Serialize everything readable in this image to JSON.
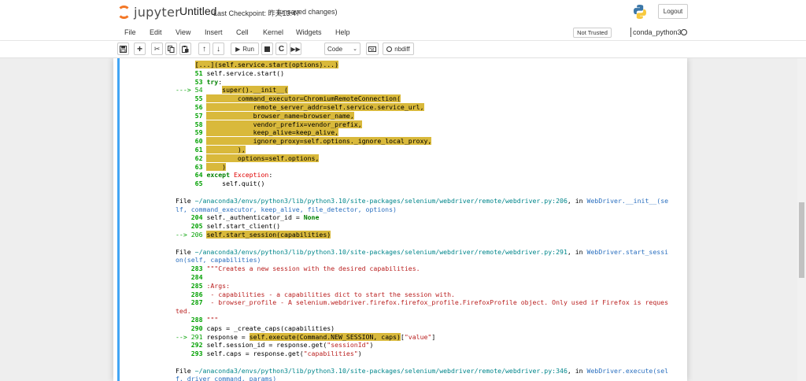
{
  "header": {
    "logo_text": "jupyter",
    "notebook_title": "Untitled",
    "checkpoint": "Last Checkpoint: 昨天13:47",
    "unsaved": "(unsaved changes)",
    "logout": "Logout"
  },
  "menu": {
    "items": [
      "File",
      "Edit",
      "View",
      "Insert",
      "Cell",
      "Kernel",
      "Widgets",
      "Help"
    ],
    "not_trusted": "Not Trusted",
    "kernel_name": "conda_python3"
  },
  "toolbar": {
    "run_label": "Run",
    "cell_type": "Code",
    "nbdiff_label": "nbdiff"
  },
  "colors": {
    "accent": "#f37726",
    "cell_bar": "#42a5f5",
    "highlight": "#d9b93b",
    "line_number": "#00a000",
    "exception": "#e00000",
    "link": "#2a6fbf"
  },
  "output_lines": [
    [
      {
        "t": "     ",
        "c": ""
      },
      {
        "t": "[...](self.service.start(options)...)",
        "c": "hl"
      }
    ],
    [
      {
        "t": "     ",
        "c": ""
      },
      {
        "t": "51",
        "c": "g"
      },
      {
        "t": " self.service.start()",
        "c": ""
      }
    ],
    [
      {
        "t": "     ",
        "c": ""
      },
      {
        "t": "53",
        "c": "g"
      },
      {
        "t": " ",
        "c": ""
      },
      {
        "t": "try",
        "c": "k"
      },
      {
        "t": ":",
        "c": ""
      }
    ],
    [
      {
        "t": "---> 54",
        "c": "gr"
      },
      {
        "t": "     ",
        "c": ""
      },
      {
        "t": "super().__init__(",
        "c": "hl"
      }
    ],
    [
      {
        "t": "     ",
        "c": ""
      },
      {
        "t": "55",
        "c": "g"
      },
      {
        "t": " ",
        "c": ""
      },
      {
        "t": "        command_executor=ChromiumRemoteConnection(",
        "c": "hl"
      }
    ],
    [
      {
        "t": "     ",
        "c": ""
      },
      {
        "t": "56",
        "c": "g"
      },
      {
        "t": " ",
        "c": ""
      },
      {
        "t": "            remote_server_addr=self.service.service_url,",
        "c": "hl"
      }
    ],
    [
      {
        "t": "     ",
        "c": ""
      },
      {
        "t": "57",
        "c": "g"
      },
      {
        "t": " ",
        "c": ""
      },
      {
        "t": "            browser_name=browser_name,",
        "c": "hl"
      }
    ],
    [
      {
        "t": "     ",
        "c": ""
      },
      {
        "t": "58",
        "c": "g"
      },
      {
        "t": " ",
        "c": ""
      },
      {
        "t": "            vendor_prefix=vendor_prefix,",
        "c": "hl"
      }
    ],
    [
      {
        "t": "     ",
        "c": ""
      },
      {
        "t": "59",
        "c": "g"
      },
      {
        "t": " ",
        "c": ""
      },
      {
        "t": "            keep_alive=keep_alive,",
        "c": "hl"
      }
    ],
    [
      {
        "t": "     ",
        "c": ""
      },
      {
        "t": "60",
        "c": "g"
      },
      {
        "t": " ",
        "c": ""
      },
      {
        "t": "            ignore_proxy=self.options._ignore_local_proxy,",
        "c": "hl"
      }
    ],
    [
      {
        "t": "     ",
        "c": ""
      },
      {
        "t": "61",
        "c": "g"
      },
      {
        "t": " ",
        "c": ""
      },
      {
        "t": "        ),",
        "c": "hl"
      }
    ],
    [
      {
        "t": "     ",
        "c": ""
      },
      {
        "t": "62",
        "c": "g"
      },
      {
        "t": " ",
        "c": ""
      },
      {
        "t": "        options=self.options,",
        "c": "hl"
      }
    ],
    [
      {
        "t": "     ",
        "c": ""
      },
      {
        "t": "63",
        "c": "g"
      },
      {
        "t": " ",
        "c": ""
      },
      {
        "t": "    )",
        "c": "hl"
      }
    ],
    [
      {
        "t": "     ",
        "c": ""
      },
      {
        "t": "64",
        "c": "g"
      },
      {
        "t": " ",
        "c": ""
      },
      {
        "t": "except",
        "c": "k"
      },
      {
        "t": " ",
        "c": ""
      },
      {
        "t": "Exception",
        "c": "r"
      },
      {
        "t": ":",
        "c": ""
      }
    ],
    [
      {
        "t": "     ",
        "c": ""
      },
      {
        "t": "65",
        "c": "g"
      },
      {
        "t": "     self.quit()",
        "c": ""
      }
    ],
    [
      {
        "t": "",
        "c": ""
      }
    ],
    [
      {
        "t": "File ",
        "c": ""
      },
      {
        "t": "~/anaconda3/envs/python3/lib/python3.10/site-packages/selenium/webdriver/remote/webdriver.py:206",
        "c": "c"
      },
      {
        "t": ", in ",
        "c": ""
      },
      {
        "t": "WebDriver.__init__(se",
        "c": "b"
      }
    ],
    [
      {
        "t": "lf, command_executor, keep_alive, file_detector, options)",
        "c": "b"
      }
    ],
    [
      {
        "t": "    ",
        "c": ""
      },
      {
        "t": "204",
        "c": "g"
      },
      {
        "t": " self._authenticator_id = ",
        "c": ""
      },
      {
        "t": "None",
        "c": "k"
      }
    ],
    [
      {
        "t": "    ",
        "c": ""
      },
      {
        "t": "205",
        "c": "g"
      },
      {
        "t": " self.start_client()",
        "c": ""
      }
    ],
    [
      {
        "t": "--> 206",
        "c": "gr"
      },
      {
        "t": " ",
        "c": ""
      },
      {
        "t": "self.start_session(capabilities)",
        "c": "hl"
      }
    ],
    [
      {
        "t": "",
        "c": ""
      }
    ],
    [
      {
        "t": "File ",
        "c": ""
      },
      {
        "t": "~/anaconda3/envs/python3/lib/python3.10/site-packages/selenium/webdriver/remote/webdriver.py:291",
        "c": "c"
      },
      {
        "t": ", in ",
        "c": ""
      },
      {
        "t": "WebDriver.start_sessi",
        "c": "b"
      }
    ],
    [
      {
        "t": "on(self, capabilities)",
        "c": "b"
      }
    ],
    [
      {
        "t": "    ",
        "c": ""
      },
      {
        "t": "283",
        "c": "g"
      },
      {
        "t": " ",
        "c": ""
      },
      {
        "t": "\"\"\"Creates a new session with the desired capabilities.",
        "c": "str"
      }
    ],
    [
      {
        "t": "    ",
        "c": ""
      },
      {
        "t": "284",
        "c": "g"
      }
    ],
    [
      {
        "t": "    ",
        "c": ""
      },
      {
        "t": "285",
        "c": "g"
      },
      {
        "t": " ",
        "c": ""
      },
      {
        "t": ":Args:",
        "c": "str"
      }
    ],
    [
      {
        "t": "    ",
        "c": ""
      },
      {
        "t": "286",
        "c": "g"
      },
      {
        "t": " ",
        "c": ""
      },
      {
        "t": " - capabilities - a capabilities dict to start the session with.",
        "c": "str"
      }
    ],
    [
      {
        "t": "    ",
        "c": ""
      },
      {
        "t": "287",
        "c": "g"
      },
      {
        "t": " ",
        "c": ""
      },
      {
        "t": " - browser_profile - A selenium.webdriver.firefox.firefox_profile.FirefoxProfile object. Only used if Firefox is reques",
        "c": "str"
      }
    ],
    [
      {
        "t": "ted.",
        "c": "str"
      }
    ],
    [
      {
        "t": "    ",
        "c": ""
      },
      {
        "t": "288",
        "c": "g"
      },
      {
        "t": " ",
        "c": ""
      },
      {
        "t": "\"\"\"",
        "c": "str"
      }
    ],
    [
      {
        "t": "    ",
        "c": ""
      },
      {
        "t": "290",
        "c": "g"
      },
      {
        "t": " caps = _create_caps(capabilities)",
        "c": ""
      }
    ],
    [
      {
        "t": "--> 291",
        "c": "gr"
      },
      {
        "t": " response = ",
        "c": ""
      },
      {
        "t": "self.execute(Command.NEW_SESSION, caps)",
        "c": "hl"
      },
      {
        "t": "[",
        "c": ""
      },
      {
        "t": "\"value\"",
        "c": "str"
      },
      {
        "t": "]",
        "c": ""
      }
    ],
    [
      {
        "t": "    ",
        "c": ""
      },
      {
        "t": "292",
        "c": "g"
      },
      {
        "t": " self.session_id = response.get(",
        "c": ""
      },
      {
        "t": "\"sessionId\"",
        "c": "str"
      },
      {
        "t": ")",
        "c": ""
      }
    ],
    [
      {
        "t": "    ",
        "c": ""
      },
      {
        "t": "293",
        "c": "g"
      },
      {
        "t": " self.caps = response.get(",
        "c": ""
      },
      {
        "t": "\"capabilities\"",
        "c": "str"
      },
      {
        "t": ")",
        "c": ""
      }
    ],
    [
      {
        "t": "",
        "c": ""
      }
    ],
    [
      {
        "t": "File ",
        "c": ""
      },
      {
        "t": "~/anaconda3/envs/python3/lib/python3.10/site-packages/selenium/webdriver/remote/webdriver.py:346",
        "c": "c"
      },
      {
        "t": ", in ",
        "c": ""
      },
      {
        "t": "WebDriver.execute(sel",
        "c": "b"
      }
    ],
    [
      {
        "t": "f, driver_command, params)",
        "c": "b"
      }
    ]
  ]
}
